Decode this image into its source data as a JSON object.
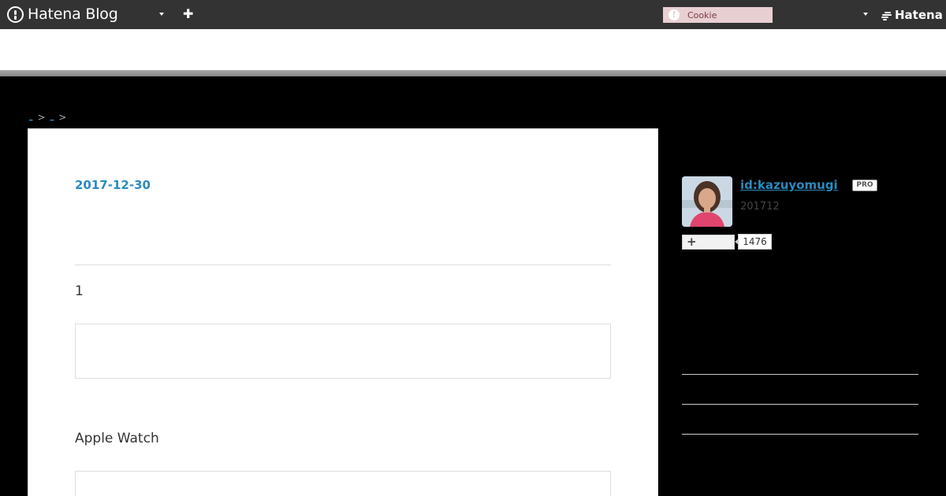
{
  "header": {
    "logo_text": "Hatena Blog",
    "cookie_alert": "!",
    "cookie_label": "Cookie",
    "hatena_label": "Hatena"
  },
  "breadcrumb": {
    "items": [
      "_",
      "_"
    ],
    "separator": ">"
  },
  "entry": {
    "date": "2017-12-30",
    "section_1_heading": "1",
    "section_2_heading": "Apple Watch"
  },
  "sidebar": {
    "user_id": "id:kazuyomugi",
    "badge": "PRO",
    "since": "201712",
    "subscribe_icon": "+",
    "subscriber_count": "1476"
  },
  "colors": {
    "header_bg": "#333333",
    "page_bg": "#000000",
    "link": "#2a8bbf",
    "cookie_bg": "#e8cfd2"
  }
}
